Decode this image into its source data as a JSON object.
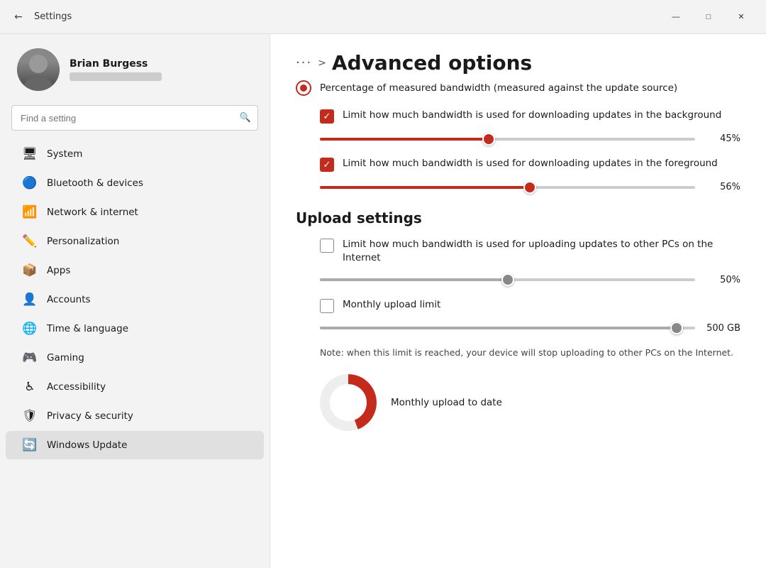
{
  "titleBar": {
    "title": "Settings",
    "backIcon": "←",
    "minIcon": "—",
    "maxIcon": "□",
    "closeIcon": "✕"
  },
  "user": {
    "name": "Brian Burgess"
  },
  "search": {
    "placeholder": "Find a setting"
  },
  "nav": [
    {
      "id": "system",
      "label": "System",
      "icon": "🖥"
    },
    {
      "id": "bluetooth",
      "label": "Bluetooth & devices",
      "icon": "🔵"
    },
    {
      "id": "network",
      "label": "Network & internet",
      "icon": "📶"
    },
    {
      "id": "personalization",
      "label": "Personalization",
      "icon": "✏️"
    },
    {
      "id": "apps",
      "label": "Apps",
      "icon": "📦"
    },
    {
      "id": "accounts",
      "label": "Accounts",
      "icon": "👤"
    },
    {
      "id": "time",
      "label": "Time & language",
      "icon": "🌐"
    },
    {
      "id": "gaming",
      "label": "Gaming",
      "icon": "🎮"
    },
    {
      "id": "accessibility",
      "label": "Accessibility",
      "icon": "♿"
    },
    {
      "id": "privacy",
      "label": "Privacy & security",
      "icon": "🛡"
    },
    {
      "id": "windows-update",
      "label": "Windows Update",
      "icon": "🔄"
    }
  ],
  "breadcrumb": {
    "dots": "···",
    "sep": ">",
    "title": "Advanced options"
  },
  "content": {
    "radioLabel": "Percentage of measured bandwidth (measured against the update source)",
    "backgroundCheckbox": "Limit how much bandwidth is used for downloading updates in the background",
    "backgroundValue": "45%",
    "backgroundPercent": 45,
    "foregroundCheckbox": "Limit how much bandwidth is used for downloading updates in the foreground",
    "foregroundValue": "56%",
    "foregroundPercent": 56,
    "uploadHeading": "Upload settings",
    "uploadInternetCheckbox": "Limit how much bandwidth is used for uploading updates to other PCs on the Internet",
    "uploadInternetValue": "50%",
    "uploadInternetPercent": 50,
    "monthlyLimitCheckbox": "Monthly upload limit",
    "monthlyLimitValue": "500 GB",
    "monthlyLimitPercent": 95,
    "noteText": "Note: when this limit is reached, your device will stop uploading to other PCs on the Internet.",
    "monthlyUploadLabel": "Monthly upload to date"
  }
}
